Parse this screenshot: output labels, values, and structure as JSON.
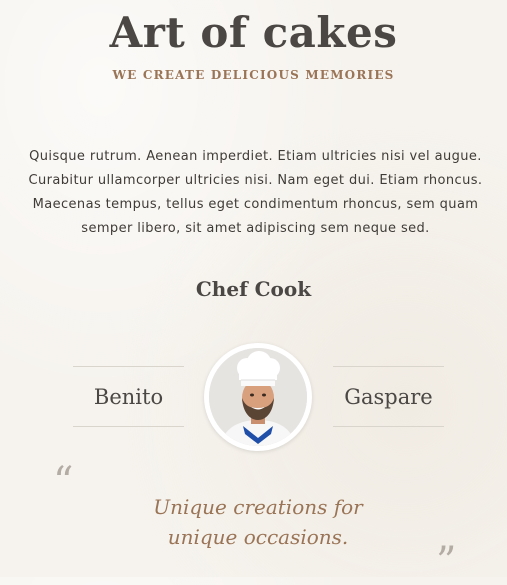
{
  "header": {
    "title": "Art of cakes",
    "subtitle": "WE CREATE DELICIOUS MEMORIES"
  },
  "intro": {
    "text": "Quisque rutrum. Aenean imperdiet. Etiam ultricies nisi vel augue. Curabitur ullamcorper ultricies nisi. Nam eget dui. Etiam rhoncus. Maecenas tempus, tellus eget condimentum rhoncus, sem quam semper libero, sit amet adipiscing sem neque sed."
  },
  "chef": {
    "section_title": "Chef Cook",
    "first_name": "Benito",
    "last_name": "Gaspare",
    "photo_icon": "chef-portrait"
  },
  "quote": {
    "open_mark": "“",
    "text": "Unique creations for unique occasions.",
    "close_mark": "”"
  },
  "colors": {
    "background": "#f6f3ee",
    "title": "#4a4744",
    "accent": "#9a7456"
  }
}
